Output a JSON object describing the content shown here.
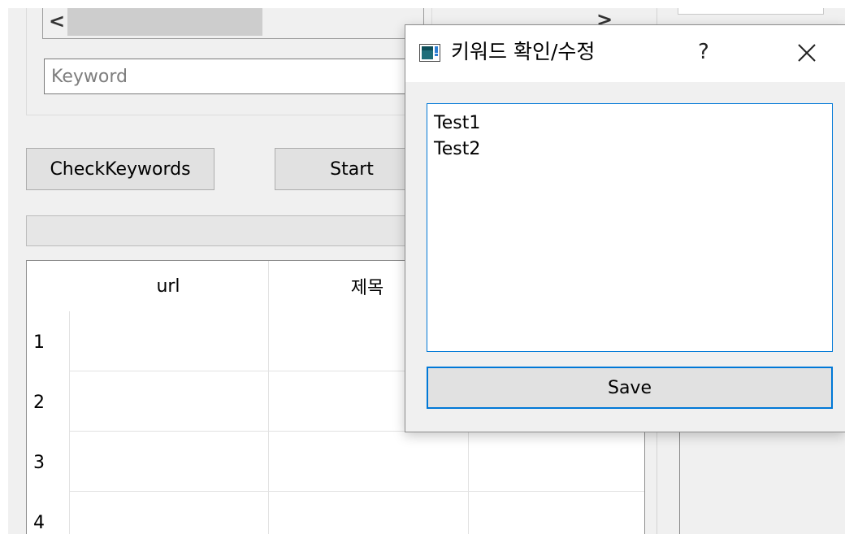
{
  "main": {
    "keyword_placeholder": "Keyword",
    "check_keywords_label": "CheckKeywords",
    "start_label": "Start",
    "scroll_left_glyph": "<",
    "scroll_right_glyph": ">"
  },
  "table": {
    "columns": [
      "url",
      "제목"
    ],
    "rows": [
      "1",
      "2",
      "3",
      "4"
    ]
  },
  "dialog": {
    "title": "키워드 확인/수정",
    "help_glyph": "?",
    "keywords": [
      "Test1",
      "Test2"
    ],
    "save_label": "Save"
  },
  "colors": {
    "accent": "#0078d7",
    "window_bg": "#f0f0f0",
    "button_bg": "#e1e1e1"
  },
  "icons": {
    "app": "app-window-icon",
    "close": "close-icon",
    "help": "help-icon"
  }
}
